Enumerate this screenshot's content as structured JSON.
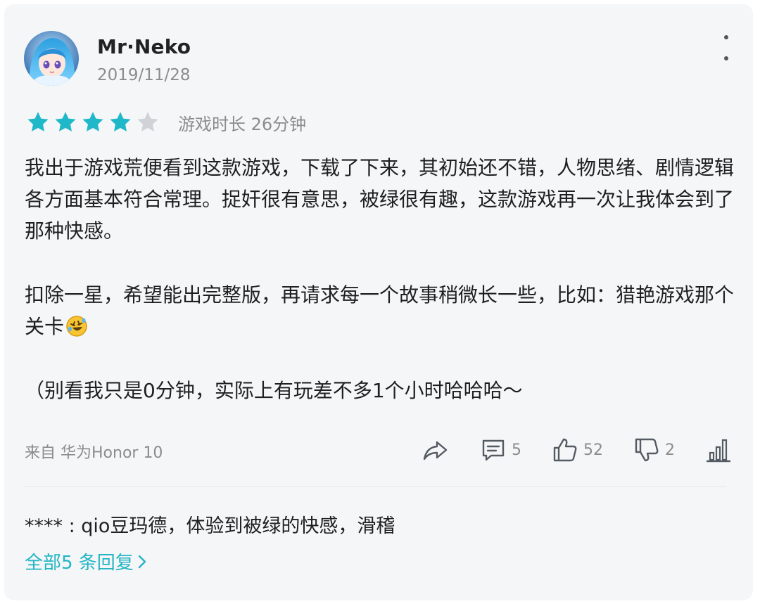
{
  "review": {
    "username": "Mr·Neko",
    "date": "2019/11/28",
    "rating": 4,
    "max_rating": 5,
    "playtime": "游戏时长 26分钟",
    "paragraphs": [
      "我出于游戏荒便看到这款游戏，下载了下来，其初始还不错，人物思绪、剧情逻辑各方面基本符合常理。捉奸很有意思，被绿很有趣，这款游戏再一次让我体会到了那种快感。",
      "扣除一星，希望能出完整版，再请求每一个故事稍微长一些，比如：猎艳游戏那个关卡",
      "（别看我只是0分钟，实际上有玩差不多1个小时哈哈哈～"
    ],
    "device": "来自 华为Honor 10",
    "actions": {
      "share_icon": "share-icon",
      "comments_count": "5",
      "likes_count": "52",
      "dislikes_count": "2",
      "stats_icon": "bar-chart-icon"
    },
    "reply": {
      "text": "**** : qio豆玛德，体验到被绿的快感，滑稽"
    },
    "all_replies_label": "全部5 条回复"
  },
  "colors": {
    "accent": "#22b5c4",
    "star_filled": "#1fb8c9",
    "star_empty": "#cfd3d8",
    "card_bg": "#f5f6f8",
    "muted_text": "#8c8c8c"
  }
}
